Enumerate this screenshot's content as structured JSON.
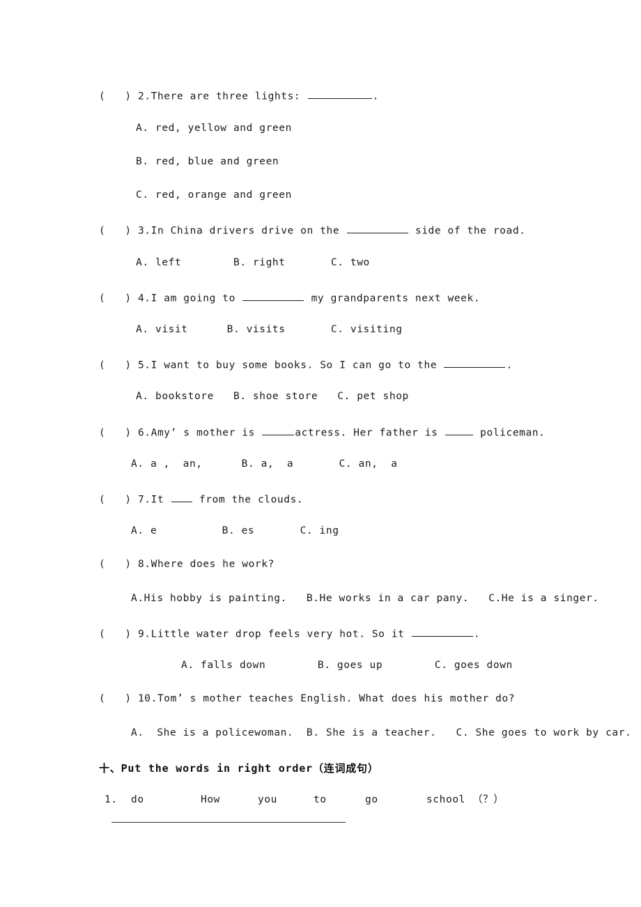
{
  "document": {
    "type": "english-worksheet-page",
    "background_color": "#ffffff",
    "text_color": "#1a1a1a"
  },
  "questions": [
    {
      "marker": "(   ) 2.",
      "stem_before": "There are three lights: ",
      "blank": "long",
      "stem_after": ".",
      "options_layout": "stacked",
      "options": [
        "A. red, yellow and green",
        "B. red, blue and green",
        "C. red, orange and green"
      ]
    },
    {
      "marker": "(   ) 3.",
      "stem_before": "In China drivers drive on the ",
      "blank": "med",
      "stem_after": " side of the road.",
      "options_layout": "inline",
      "options_text": "A. left        B. right       C. two"
    },
    {
      "marker": "(   ) 4.",
      "stem_before": "I am going to ",
      "blank": "med",
      "stem_after": " my grandparents next week.",
      "options_layout": "inline",
      "options_text": "A. visit      B. visits       C. visiting"
    },
    {
      "marker": "(   ) 5.",
      "stem_before": "I want to buy some books. So I can go to the ",
      "blank": "med",
      "stem_after": ".",
      "options_layout": "inline",
      "options_text": "A. bookstore   B. shoe store   C. pet shop"
    },
    {
      "marker": "(   ) 6.",
      "stem_before": "Amy’ s mother is ",
      "blank": "short",
      "stem_after": "actress. Her father is ",
      "blank2": "tiny",
      "stem_after2": " policeman.",
      "options_layout": "inline",
      "options_text": "A. a ,  an,      B. a,  a       C. an,  a"
    },
    {
      "marker": "(   ) 7.",
      "stem_before": "It ",
      "blank": "xshort",
      "stem_after": " from the clouds.",
      "options_layout": "inline",
      "options_text": "A. e          B. es       C. ing"
    },
    {
      "marker": "(   ) 8.",
      "stem_before": "Where does he work?",
      "blank": "none",
      "stem_after": "",
      "options_layout": "inline",
      "options_text": "A.His hobby is painting.   B.He works in a car pany.   C.He is a singer."
    },
    {
      "marker": "(   ) 9.",
      "stem_before": "Little water drop feels very hot. So it ",
      "blank": "med",
      "stem_after": ".",
      "options_layout": "inline",
      "options_text": "A. falls down        B. goes up        C. goes down"
    },
    {
      "marker": "(   ) 10.",
      "stem_before": "Tom’ s mother teaches English. What does his mother do?",
      "blank": "none",
      "stem_after": "",
      "options_layout": "inline",
      "options_text": "A.  She is a policewoman.  B. She is a teacher.   C. She goes to work by car."
    }
  ],
  "section": {
    "heading": "十、Put the words in right order（连词成句）",
    "item_number": "1.",
    "scrambled_words": [
      "do",
      "How",
      "you",
      "to",
      "go",
      "school",
      "（？）"
    ]
  }
}
